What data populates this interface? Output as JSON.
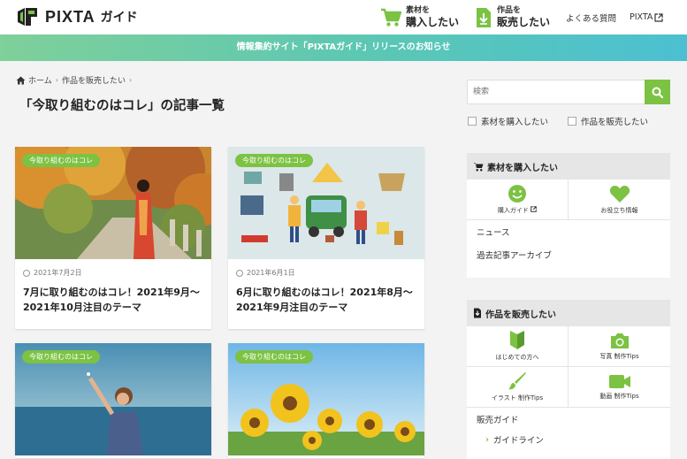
{
  "header": {
    "logo_text": "PIXTA",
    "logo_sub": "ガイド",
    "buy": {
      "line1": "素材を",
      "line2": "購入したい",
      "icon": "cart-icon"
    },
    "sell": {
      "line1": "作品を",
      "line2": "販売したい",
      "icon": "download-icon"
    },
    "faq_label": "よくある質問",
    "pixta_label": "PIXTA",
    "accent": "#7cc243"
  },
  "notice": {
    "text": "情報集約サイト「PIXTAガイド」リリースのお知らせ"
  },
  "breadcrumb": {
    "home": "ホーム",
    "category": "作品を販売したい"
  },
  "page_title": "「今取り組むのはコレ」の記事一覧",
  "articles": [
    {
      "tag": "今取り組むのはコレ",
      "date": "2021年7月2日",
      "title": "7月に取り組むのはコレ！2021年9月〜2021年10月注目のテーマ"
    },
    {
      "tag": "今取り組むのはコレ",
      "date": "2021年6月1日",
      "title": "6月に取り組むのはコレ！2021年8月〜2021年9月注目のテーマ"
    },
    {
      "tag": "今取り組むのはコレ"
    },
    {
      "tag": "今取り組むのはコレ"
    }
  ],
  "sidebar": {
    "search_placeholder": "検索",
    "check_buy": "素材を購入したい",
    "check_sell": "作品を販売したい",
    "buy_widget": {
      "title": "素材を購入したい",
      "tiles": [
        {
          "label": "購入ガイド",
          "icon": "smile-icon"
        },
        {
          "label": "お役立ち情報",
          "icon": "heart-icon"
        }
      ],
      "links": [
        "ニュース",
        "過去記事アーカイブ"
      ]
    },
    "sell_widget": {
      "title": "作品を販売したい",
      "tiles": [
        {
          "label": "はじめての方へ",
          "icon": "beginner-icon"
        },
        {
          "label": "写真 制作Tips",
          "icon": "camera-icon"
        },
        {
          "label": "イラスト 制作Tips",
          "icon": "brush-icon"
        },
        {
          "label": "動画 制作Tips",
          "icon": "video-icon"
        }
      ],
      "links": [
        "販売ガイド"
      ],
      "sublinks": [
        "ガイドライン"
      ]
    }
  }
}
